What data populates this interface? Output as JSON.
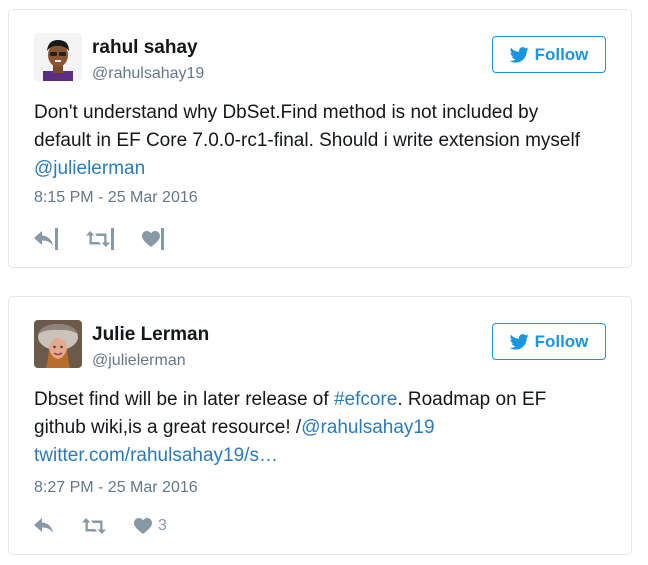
{
  "accent_color": "#1b95e0",
  "link_color": "#2b7bb9",
  "tweets": [
    {
      "display_name": "rahul sahay",
      "screen_name": "@rahulsahay19",
      "follow_label": "Follow",
      "text_before": "Don't understand why DbSet.Find method is not included by default in EF Core 7.0.0-rc1-final. Should i write extension myself ",
      "mention": "@julielerman",
      "timestamp": "8:15 PM - 25 Mar 2016",
      "actions": {
        "reply_icon": "reply-icon",
        "retweet_icon": "retweet-icon",
        "like_icon": "heart-icon"
      }
    },
    {
      "display_name": "Julie Lerman",
      "screen_name": "@julielerman",
      "follow_label": "Follow",
      "text_part1": "Dbset find will be in later release of ",
      "hashtag": "#efcore",
      "text_part2": ". Roadmap on EF github wiki,is a great resource! /",
      "mention": "@rahulsahay19",
      "url": "twitter.com/rahulsahay19/s…",
      "timestamp": "8:27 PM - 25 Mar 2016",
      "like_count": "3",
      "actions": {
        "reply_icon": "reply-icon",
        "retweet_icon": "retweet-icon",
        "like_icon": "heart-icon"
      }
    }
  ]
}
